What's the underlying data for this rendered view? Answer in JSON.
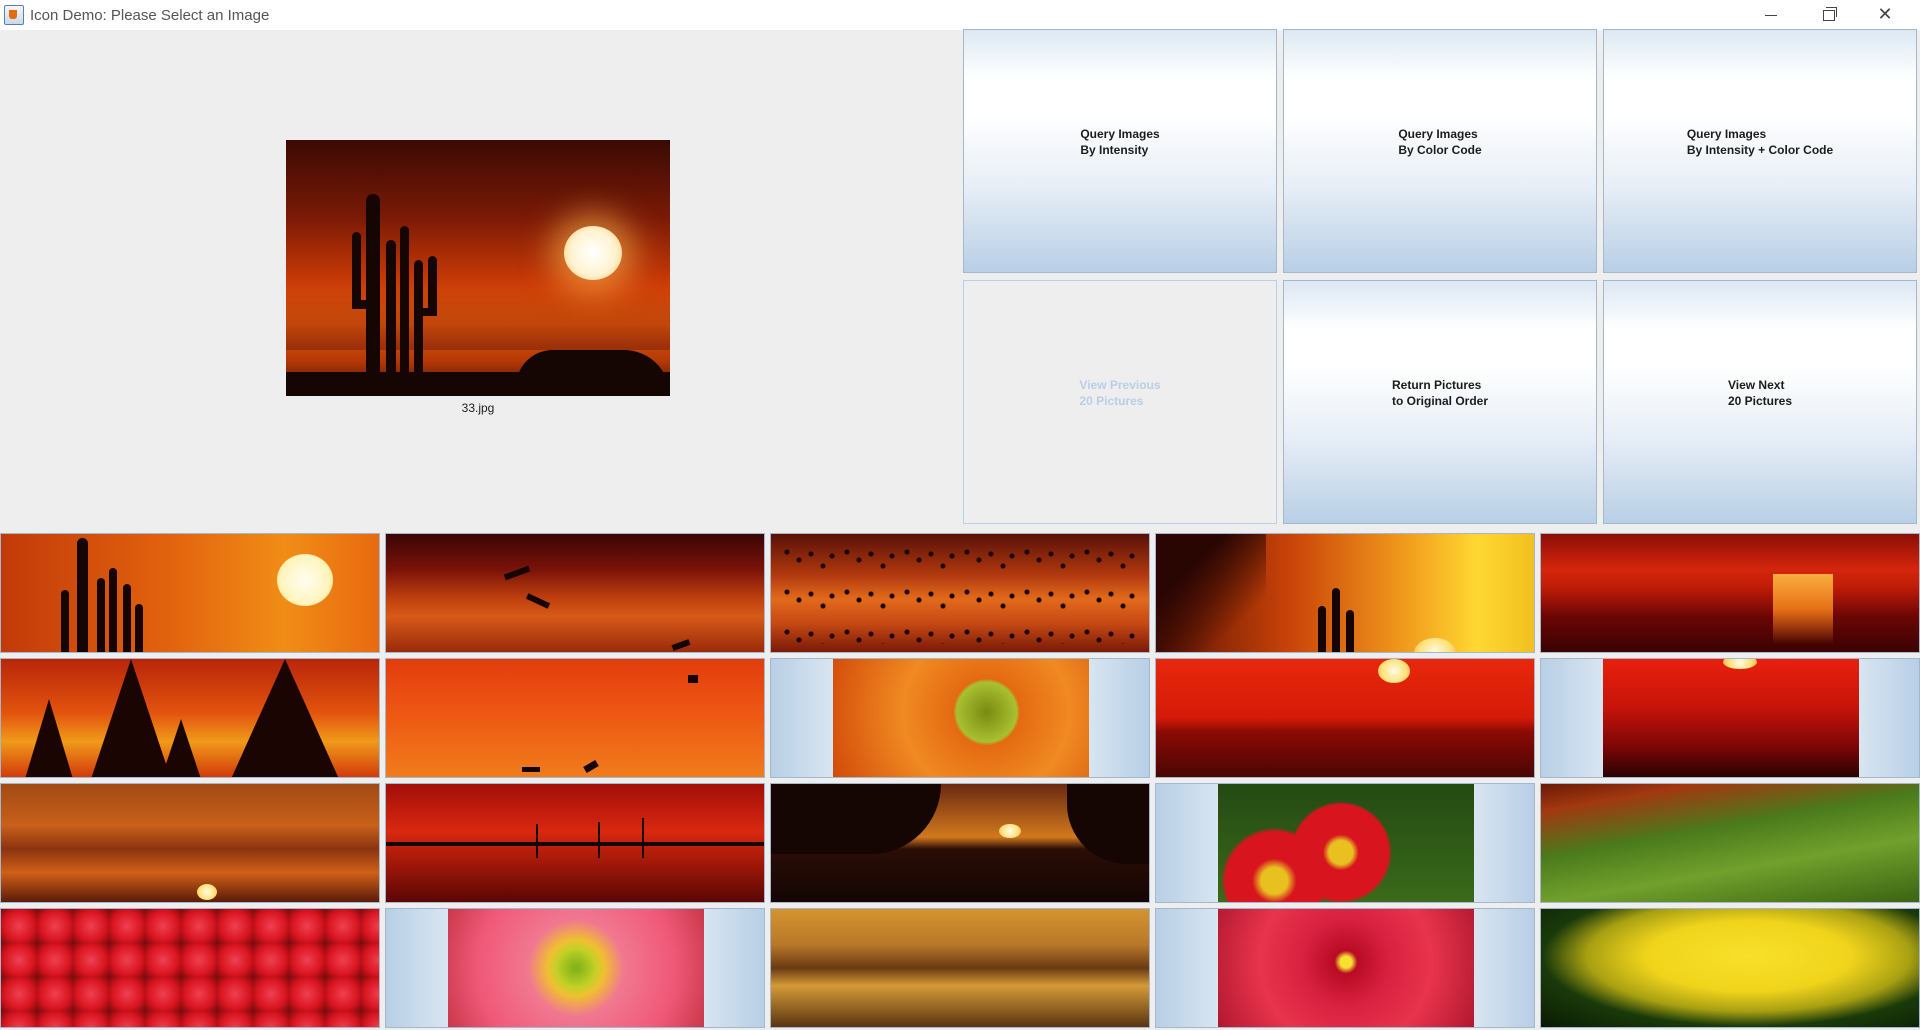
{
  "window": {
    "title": "Icon Demo: Please Select an Image",
    "controls": {
      "minimize": "minimize-icon",
      "maximize": "restore-icon",
      "close": "close-icon"
    }
  },
  "preview": {
    "caption": "33.jpg",
    "image": "desert-cactus-sunset"
  },
  "buttons": [
    {
      "label": "Query Images\nBy Intensity",
      "enabled": true
    },
    {
      "label": "Query Images\nBy Color Code",
      "enabled": true
    },
    {
      "label": "Query Images\nBy Intensity + Color Code",
      "enabled": true
    },
    {
      "label": "View Previous\n20 Pictures",
      "enabled": false
    },
    {
      "label": "Return Pictures\nto Original Order",
      "enabled": true
    },
    {
      "label": "View Next\n20 Pictures",
      "enabled": true
    }
  ],
  "colors": {
    "button_gradient_edge": "#b8cfe5",
    "disabled_text": "#b8cfe5",
    "window_bg": "#eeeeee"
  },
  "thumbnails": [
    {
      "image": "cactus-sunset"
    },
    {
      "image": "birds-red-sky"
    },
    {
      "image": "flock-of-birds"
    },
    {
      "image": "tree-cactus-sunset"
    },
    {
      "image": "sea-sunset-red"
    },
    {
      "image": "pine-tree-sunset"
    },
    {
      "image": "birds-over-water"
    },
    {
      "image": "orange-flower"
    },
    {
      "image": "sunset-over-sea"
    },
    {
      "image": "red-sunset-horizon"
    },
    {
      "image": "cloudy-sunset"
    },
    {
      "image": "sailboats-harbor"
    },
    {
      "image": "beach-rocks-sunset"
    },
    {
      "image": "red-primrose"
    },
    {
      "image": "green-landscape"
    },
    {
      "image": "red-berries"
    },
    {
      "image": "pink-daisy"
    },
    {
      "image": "clouds-sunset"
    },
    {
      "image": "red-hibiscus"
    },
    {
      "image": "yellow-flowers"
    }
  ]
}
